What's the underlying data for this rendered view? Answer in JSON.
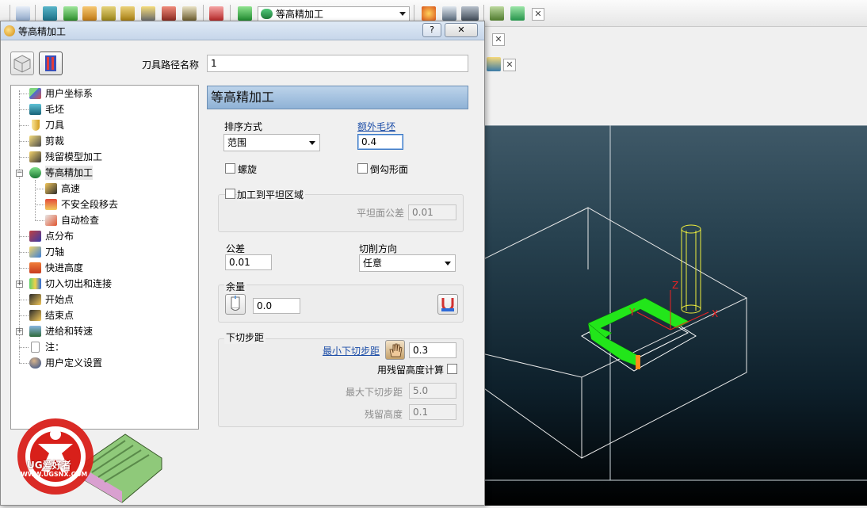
{
  "toolbar": {
    "combo_value": "等高精加工"
  },
  "dialog": {
    "title": "等高精加工",
    "help_label": "?",
    "close_label": "✕",
    "path_name_label": "刀具路径名称",
    "path_name_value": "1",
    "section_title": "等高精加工"
  },
  "tree": {
    "items": [
      {
        "label": "用户坐标系"
      },
      {
        "label": "毛坯"
      },
      {
        "label": "刀具"
      },
      {
        "label": "剪裁"
      },
      {
        "label": "残留模型加工"
      },
      {
        "label": "等高精加工"
      },
      {
        "label": "高速"
      },
      {
        "label": "不安全段移去"
      },
      {
        "label": "自动检查"
      },
      {
        "label": "点分布"
      },
      {
        "label": "刀轴"
      },
      {
        "label": "快进高度"
      },
      {
        "label": "切入切出和连接"
      },
      {
        "label": "开始点"
      },
      {
        "label": "结束点"
      },
      {
        "label": "进给和转速"
      },
      {
        "label": "注："
      },
      {
        "label": "用户定义设置"
      }
    ]
  },
  "form": {
    "sort_label": "排序方式",
    "sort_value": "范围",
    "extra_stock_label": "额外毛坯",
    "extra_stock_value": "0.4",
    "spiral_label": "螺旋",
    "undercut_label": "倒勾形面",
    "flat_machining_label": "加工到平坦区域",
    "flat_tolerance_label": "平坦面公差",
    "flat_tolerance_value": "0.01",
    "tolerance_label": "公差",
    "tolerance_value": "0.01",
    "cut_direction_label": "切削方向",
    "cut_direction_value": "任意",
    "allowance_label": "余量",
    "allowance_value": "0.0",
    "stepdown_label": "下切步距",
    "min_stepdown_label": "最小下切步距",
    "min_stepdown_value": "0.3",
    "use_scallop_label": "用残留高度计算",
    "max_stepdown_label": "最大下切步距",
    "max_stepdown_value": "5.0",
    "scallop_label": "残留高度",
    "scallop_value": "0.1"
  },
  "viewport": {
    "axis_z": "Z",
    "axis_y": "Y",
    "axis_x": "X"
  },
  "watermark": {
    "brand": "UG爱好者",
    "url": "WWW.UGSNX.COM"
  }
}
